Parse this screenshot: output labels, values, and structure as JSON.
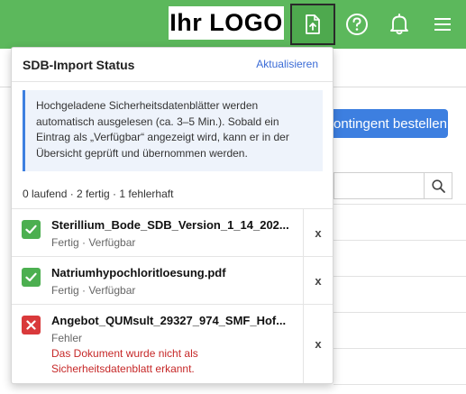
{
  "header": {
    "logo_text": "Ihr LOGO",
    "icons": [
      "upload-icon",
      "help-icon",
      "bell-icon",
      "menu-icon"
    ],
    "bar_color": "#5cb85c"
  },
  "background": {
    "order_button_label": "ontingent bestellen",
    "search_icon": "search-icon"
  },
  "panel": {
    "title": "SDB-Import Status",
    "refresh_label": "Aktualisieren",
    "info_text": "Hochgeladene Sicherheitsdatenblätter werden automatisch ausgelesen (ca. 3–5 Min.). Sobald ein Eintrag als „Verfügbar“ angezeigt wird, kann er in der Übersicht geprüft und übernommen werden.",
    "summary": "0 laufend · 2 fertig · 1 fehlerhaft",
    "items": [
      {
        "name": "Sterillium_Bode_SDB_Version_1_14_202...",
        "status_line": "Fertig · Verfügbar",
        "state": "ok",
        "remove_label": "x"
      },
      {
        "name": "Natriumhypochloritloesung.pdf",
        "status_line": "Fertig · Verfügbar",
        "state": "ok",
        "remove_label": "x"
      },
      {
        "name": "Angebot_QUMsult_29327_974_SMF_Hof...",
        "status_line": "Fehler",
        "error_text": "Das Dokument wurde nicht als Sicherheitsdatenblatt erkannt.",
        "state": "error",
        "remove_label": "x"
      }
    ]
  },
  "colors": {
    "ok": "#4caf50",
    "error": "#d9393b",
    "link": "#3a6bd6",
    "info_bg": "#eef3fb"
  }
}
